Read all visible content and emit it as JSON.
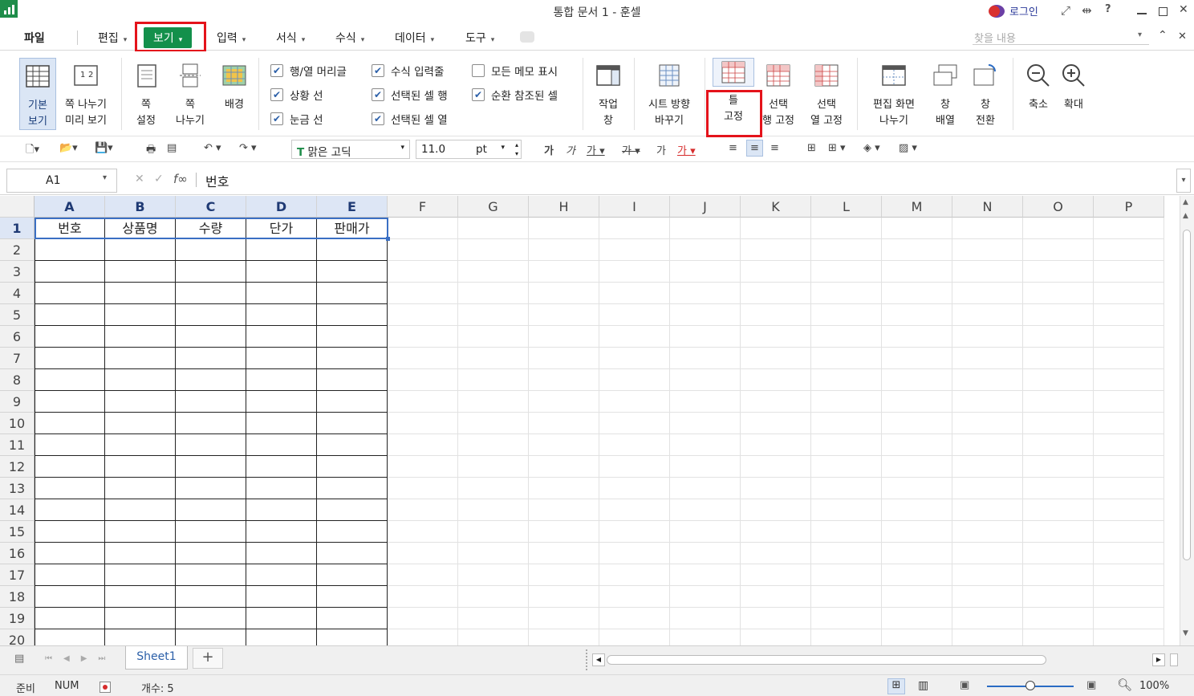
{
  "window": {
    "title": "통합 문서 1 - 훈셀",
    "login": "로그인"
  },
  "menubar": {
    "items": [
      "파일",
      "편집",
      "보기",
      "입력",
      "서식",
      "수식",
      "데이터",
      "도구"
    ],
    "search_placeholder": "찾을 내용"
  },
  "ribbon": {
    "view_normal": "기본\n보기",
    "page_break_preview": "쪽 나누기\n미리 보기",
    "page_setup": "쪽\n설정",
    "page_break": "쪽\n나누기",
    "background": "배경",
    "checkboxes": [
      {
        "label": "행/열 머리글",
        "checked": true
      },
      {
        "label": "수식 입력줄",
        "checked": true
      },
      {
        "label": "모든 메모 표시",
        "checked": false
      },
      {
        "label": "상황 선",
        "checked": true
      },
      {
        "label": "선택된 셀 행",
        "checked": true
      },
      {
        "label": "순환 참조된 셀",
        "checked": true
      },
      {
        "label": "눈금 선",
        "checked": true
      },
      {
        "label": "선택된 셀 열",
        "checked": true
      }
    ],
    "work_window": "작업\n창",
    "sheet_direction": "시트 방향\n바꾸기",
    "freeze_panes": "틀\n고정",
    "freeze_rows": "선택\n행 고정",
    "freeze_cols": "선택\n열 고정",
    "split_screen": "편집 화면\n나누기",
    "arrange": "창\n배열",
    "switch": "창\n전환",
    "zoom_out": "축소",
    "zoom_in": "확대"
  },
  "toolbar": {
    "font": "맑은 고딕",
    "size": "11.0",
    "unit": "pt"
  },
  "formula": {
    "cell_ref": "A1",
    "content": "번호"
  },
  "sheet": {
    "columns": [
      "A",
      "B",
      "C",
      "D",
      "E",
      "F",
      "G",
      "H",
      "I",
      "J",
      "K",
      "L",
      "M",
      "N",
      "O",
      "P"
    ],
    "rows": [
      "1",
      "2",
      "3",
      "4",
      "5",
      "6",
      "7",
      "8",
      "9",
      "10",
      "11",
      "12",
      "13",
      "14",
      "15",
      "16",
      "17",
      "18",
      "19",
      "20"
    ],
    "header_cells": [
      "번호",
      "상품명",
      "수량",
      "단가",
      "판매가"
    ]
  },
  "tabs": {
    "sheet1": "Sheet1",
    "add": "+"
  },
  "status": {
    "ready": "준비",
    "num": "NUM",
    "count": "개수: 5",
    "zoom": "100%"
  }
}
